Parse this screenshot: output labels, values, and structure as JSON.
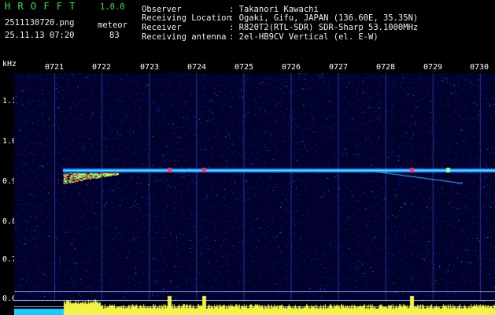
{
  "app": {
    "name": "H R O F F T",
    "version": "1.0.0"
  },
  "capture": {
    "file": "2511130720.png",
    "datetime": "25.11.13 07:20",
    "counter_label": "meteor",
    "counter_value": "83"
  },
  "info": [
    {
      "key": "Observer",
      "value": ": Takanori Kawachi"
    },
    {
      "key": "Receiving Location",
      "value": ": Ogaki, Gifu, JAPAN (136.60E, 35.35N)"
    },
    {
      "key": "Receiver",
      "value": ": R820T2(RTL-SDR) SDR-Sharp 53.1000MHz"
    },
    {
      "key": "Receiving antenna",
      "value": ": 2el-HB9CV Vertical (el. E-W)"
    }
  ],
  "axis": {
    "y_unit": "kHz",
    "y_ticks": [
      "1.1",
      "1.0",
      "0.9",
      "0.8",
      "0.7",
      "0.6"
    ],
    "x_ticks": [
      "0721",
      "0722",
      "0723",
      "0724",
      "0725",
      "0726",
      "0727",
      "0728",
      "0729",
      "0730"
    ]
  },
  "colors": {
    "green": "#3ee04a",
    "yellow": "#f2f24a",
    "trace": "#7ef0ff",
    "background": "#00002a"
  }
}
